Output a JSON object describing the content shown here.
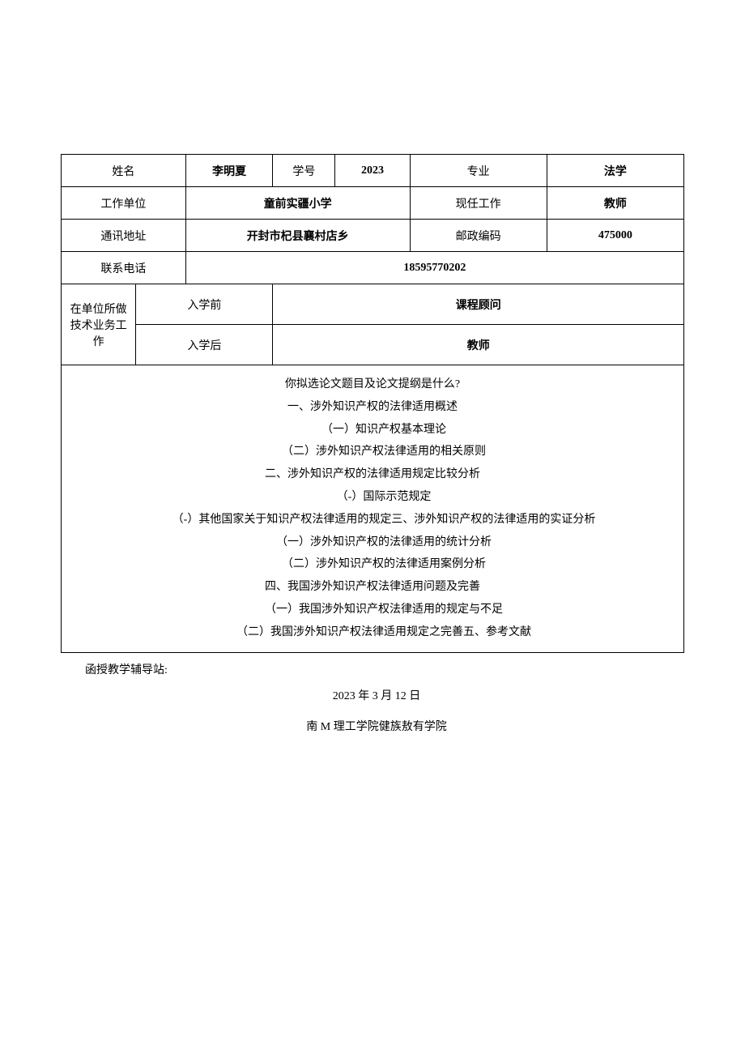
{
  "row1": {
    "name_label": "姓名",
    "name_value": "李明夏",
    "sid_label": "学号",
    "sid_value": "2023",
    "major_label": "专业",
    "major_value": "法学"
  },
  "row2": {
    "workunit_label": "工作单位",
    "workunit_value": "童前实疆小学",
    "job_label": "现任工作",
    "job_value": "教师"
  },
  "row3": {
    "addr_label": "通讯地址",
    "addr_value": "开封市杞县襄村店乡",
    "post_label": "邮政编码",
    "post_value": "475000"
  },
  "row4": {
    "phone_label": "联系电话",
    "phone_value": "18595770202"
  },
  "tech": {
    "side_label": "在单位所做技术业务工作",
    "before_label": "入学前",
    "before_value": "课程顾问",
    "after_label": "入学后",
    "after_value": "教师"
  },
  "outline": {
    "q": "你拟选论文题目及论文提纲是什么?",
    "l1": "一、涉外知识产权的法律适用概述",
    "l1a": "（一）知识产权基本理论",
    "l1b": "（二）涉外知识产权法律适用的相关原则",
    "l2": "二、涉外知识产权的法律适用规定比较分析",
    "l2a": "（-）国际示范规定",
    "l2b": "（-）其他国家关于知识产权法律适用的规定三、涉外知识产权的法律适用的实证分析",
    "l2c": "（一）涉外知识产权的法律适用的统计分析",
    "l2d": "（二）涉外知识产权的法律适用案例分析",
    "l4": "四、我国涉外知识产权法律适用问题及完善",
    "l4a": "（一）我国涉外知识产权法律适用的规定与不足",
    "l4b": "（二）我国涉外知识产权法律适用规定之完善五、参考文献"
  },
  "footer": {
    "station": "函授教学辅导站:",
    "date": "2023 年 3 月 12 日",
    "institution": "南 M 理工学院健族敖有学院"
  }
}
